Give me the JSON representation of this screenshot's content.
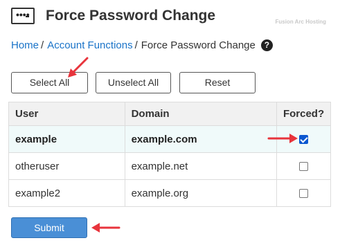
{
  "header": {
    "title": "Force Password Change",
    "icon": "password-field-icon",
    "watermark": "Fusion Arc Hosting"
  },
  "breadcrumb": {
    "items": [
      {
        "label": "Home",
        "link": true
      },
      {
        "label": "Account Functions",
        "link": true
      },
      {
        "label": "Force Password Change",
        "link": false
      }
    ],
    "separator": "/",
    "help_icon": "question-circle-icon"
  },
  "toolbar": {
    "select_all": "Select All",
    "unselect_all": "Unselect All",
    "reset": "Reset"
  },
  "table": {
    "columns": [
      "User",
      "Domain",
      "Forced?"
    ],
    "rows": [
      {
        "user": "example",
        "domain": "example.com",
        "forced": true,
        "highlighted": true
      },
      {
        "user": "otheruser",
        "domain": "example.net",
        "forced": false,
        "highlighted": false
      },
      {
        "user": "example2",
        "domain": "example.org",
        "forced": false,
        "highlighted": false
      }
    ]
  },
  "submit_label": "Submit",
  "colors": {
    "link": "#1a73c8",
    "submit_bg": "#4a8fd6",
    "arrow": "#e8343c",
    "checkbox_checked": "#0b57d0",
    "highlight_row": "#f0fafa"
  },
  "annotations": [
    "arrow-select-all",
    "arrow-checkbox",
    "arrow-submit"
  ]
}
